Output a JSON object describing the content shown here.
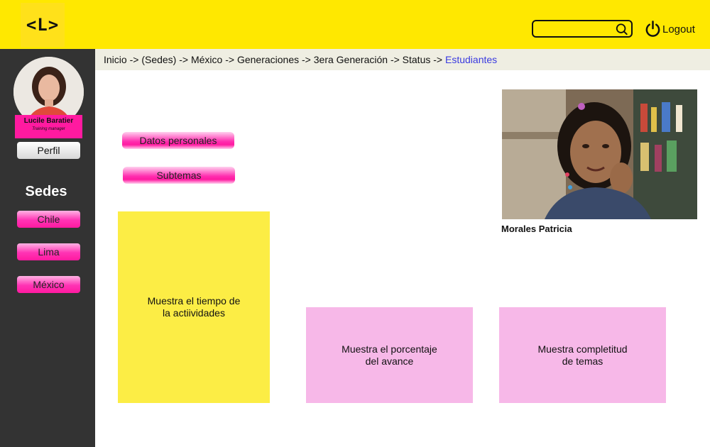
{
  "header": {
    "logo_text": "<L>",
    "search": {
      "value": "",
      "placeholder": ""
    },
    "logout_label": "Logout",
    "icons": {
      "search": "search-icon",
      "logout": "power-icon"
    }
  },
  "sidebar": {
    "user": {
      "name": "Lucile Baratier",
      "role": "Training manager"
    },
    "perfil_label": "Perfil",
    "sedes_title": "Sedes",
    "sedes": [
      {
        "label": "Chile"
      },
      {
        "label": "Lima"
      },
      {
        "label": "México"
      }
    ]
  },
  "breadcrumb": {
    "items": [
      "Inicio",
      "(Sedes)",
      "México",
      "Generaciones",
      "3era Generación",
      "Status"
    ],
    "separator": "->",
    "current": "Estudiantes"
  },
  "main": {
    "buttons": {
      "personal_data": "Datos personales",
      "subtopics": "Subtemas"
    },
    "student_name": "Morales Patricia",
    "panels": {
      "time": "Muestra el tiempo de\nla actiividades",
      "progress": "Muestra el porcentaje\ndel avance",
      "completion": "Muestra completitud\nde temas"
    }
  },
  "colors": {
    "header_bg": "#ffe800",
    "sidebar_bg": "#333333",
    "accent_pink": "#ff1aa0",
    "breadcrumb_bg": "#efeee2",
    "current_crumb": "#3a3ae0",
    "panel_yellow": "#fced45",
    "panel_pink": "#f7b8e8"
  }
}
